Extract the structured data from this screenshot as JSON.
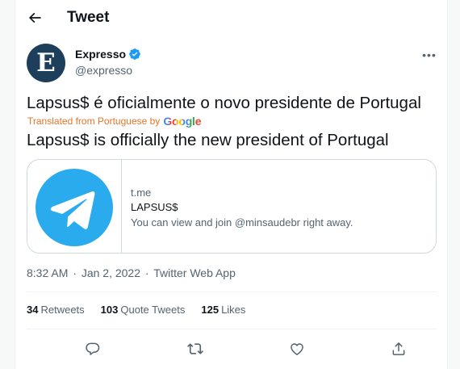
{
  "header": {
    "title": "Tweet",
    "back_icon": "arrow-left-icon"
  },
  "author": {
    "avatar_letter": "E",
    "name": "Expresso",
    "handle": "@expresso",
    "verified": true,
    "verified_icon": "verified-badge-icon",
    "verified_color": "#1d9bf0"
  },
  "tweet": {
    "text": "Lapsus$ é oficialmente o novo presidente de Portugal",
    "translated_label": "Translated from Portuguese by",
    "translator": "Google",
    "translation": "Lapsus$ is officially the new president of Portugal"
  },
  "card": {
    "thumb_icon": "telegram-logo-icon",
    "thumb_color": "#2aabee",
    "domain": "t.me",
    "title": "LAPSUS$",
    "description": "You can view and join @minsaudebr right away."
  },
  "meta": {
    "time": "8:32 AM",
    "date": "Jan 2, 2022",
    "source": "Twitter Web App"
  },
  "stats": {
    "retweets_count": "34",
    "retweets_label": "Retweets",
    "quotes_count": "103",
    "quotes_label": "Quote Tweets",
    "likes_count": "125",
    "likes_label": "Likes"
  },
  "actions": [
    "reply-icon",
    "retweet-icon",
    "like-icon",
    "share-icon"
  ],
  "colors": {
    "text": "#0f1419",
    "secondary": "#536471",
    "accent": "#1d9bf0",
    "translate_label": "#e0762b"
  }
}
